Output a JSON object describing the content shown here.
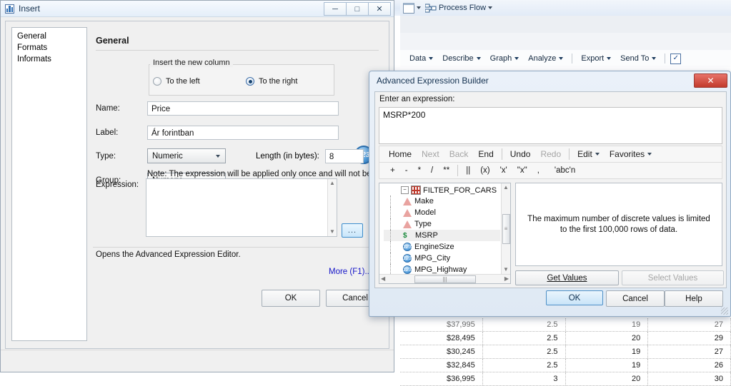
{
  "background": {
    "process_flow_label": "Process Flow",
    "menu_items": [
      "Data",
      "Describe",
      "Graph",
      "Analyze",
      "Export",
      "Send To"
    ],
    "grid_rows": [
      {
        "price": "$37,995",
        "c2": "2.5",
        "c3": "19",
        "c4": "27",
        "faded": true
      },
      {
        "price": "$28,495",
        "c2": "2.5",
        "c3": "20",
        "c4": "29",
        "faded": false
      },
      {
        "price": "$30,245",
        "c2": "2.5",
        "c3": "19",
        "c4": "27",
        "faded": false
      },
      {
        "price": "$32,845",
        "c2": "2.5",
        "c3": "19",
        "c4": "26",
        "faded": false
      },
      {
        "price": "$36,995",
        "c2": "3",
        "c3": "20",
        "c4": "30",
        "faded": false
      }
    ]
  },
  "insert_dialog": {
    "title": "Insert",
    "window_buttons": {
      "minimize": "─",
      "maximize": "□",
      "close": "✕"
    },
    "nav_items": [
      "General",
      "Formats",
      "Informats"
    ],
    "page_title": "General",
    "group_legend": "Insert the new column",
    "radio_left": "To the left",
    "radio_right": "To the right",
    "selected_radio": "To the right",
    "fields": {
      "name_label": "Name:",
      "name_value": "Price",
      "label_label": "Label:",
      "label_value": "Ár forintban",
      "type_label": "Type:",
      "type_value": "Numeric",
      "length_label": "Length (in bytes):",
      "length_value": "8",
      "group_label": "Group:",
      "group_value": "Numeric",
      "expression_label": "Expression:",
      "expression_value": ""
    },
    "note": "Note: The expression will be applied only once and will not be stored",
    "ellipsis_button": "...",
    "help_text": "Opens the Advanced Expression Editor.",
    "more_link": "More (F1)...",
    "ok_label": "OK",
    "cancel_label": "Cancel"
  },
  "expression_builder": {
    "title": "Advanced Expression Builder",
    "close_glyph": "✕",
    "enter_label": "Enter an expression:",
    "expression_value": "MSRP*200",
    "toolbar_nav": [
      {
        "label": "Home",
        "enabled": true
      },
      {
        "label": "Next",
        "enabled": false
      },
      {
        "label": "Back",
        "enabled": false
      },
      {
        "label": "End",
        "enabled": true
      }
    ],
    "toolbar_edit": [
      {
        "label": "Undo",
        "enabled": true
      },
      {
        "label": "Redo",
        "enabled": false
      }
    ],
    "toolbar_menus": [
      {
        "label": "Edit"
      },
      {
        "label": "Favorites"
      }
    ],
    "operators": [
      "+",
      "-",
      "*",
      "/",
      "**",
      "||",
      "(x)",
      "'x'",
      "\"x\"",
      ",",
      "'abc'n"
    ],
    "tree": {
      "root": "FILTER_FOR_CARS",
      "nodes": [
        {
          "label": "Make",
          "icon": "char-triangle-icon"
        },
        {
          "label": "Model",
          "icon": "char-triangle-icon"
        },
        {
          "label": "Type",
          "icon": "char-triangle-icon"
        },
        {
          "label": "MSRP",
          "icon": "currency-icon"
        },
        {
          "label": "EngineSize",
          "icon": "numeric-icon"
        },
        {
          "label": "MPG_City",
          "icon": "numeric-icon"
        },
        {
          "label": "MPG_Highway",
          "icon": "numeric-icon"
        }
      ],
      "selected": "MSRP"
    },
    "values_message": "The maximum number of discrete values is limited to the first 100,000 rows of data.",
    "get_values_label": "Get Values",
    "select_values_label": "Select Values",
    "ok_label": "OK",
    "cancel_label": "Cancel",
    "help_label": "Help"
  },
  "colors": {
    "dialog_face": "#f0f0f0",
    "accent_blue": "#2b6fae",
    "close_red": "#c23a2c",
    "link_blue": "#1414c8"
  }
}
